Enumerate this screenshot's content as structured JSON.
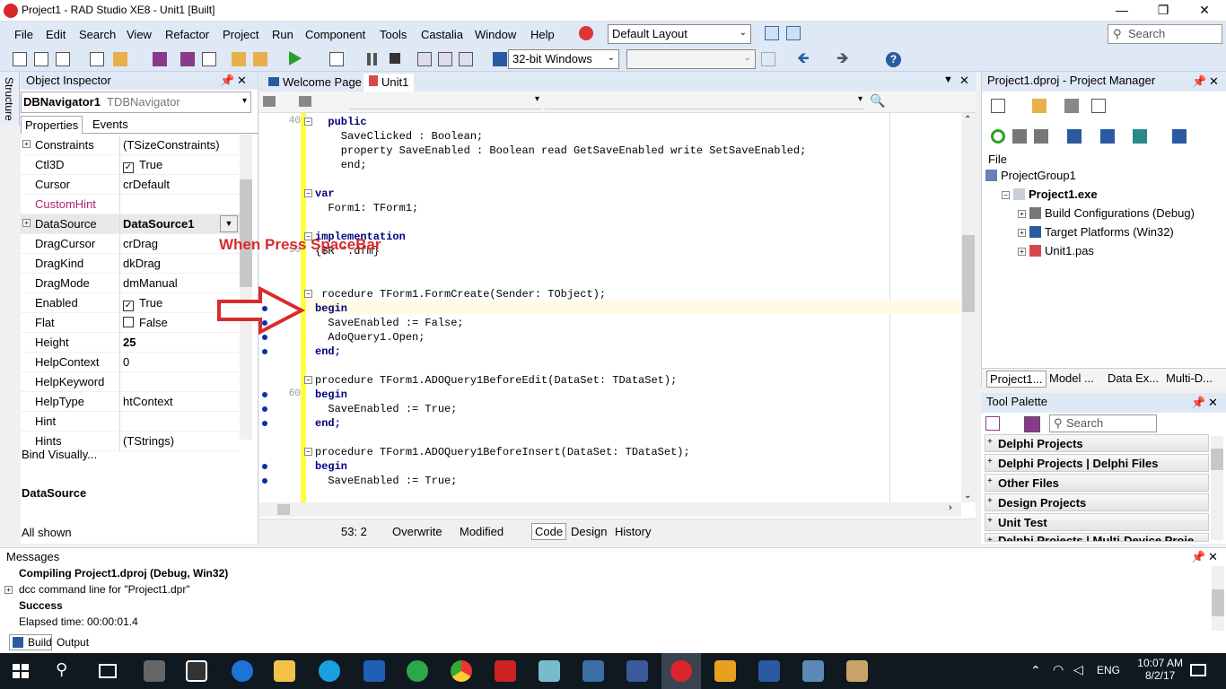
{
  "window": {
    "title": "Project1 - RAD Studio XE8 - Unit1 [Built]",
    "minimize": "—",
    "maximize": "❐",
    "close": "✕"
  },
  "menu": {
    "items": [
      "File",
      "Edit",
      "Search",
      "View",
      "Refactor",
      "Project",
      "Run",
      "Component",
      "Tools",
      "Castalia",
      "Window",
      "Help"
    ],
    "layout": "Default Layout",
    "search_placeholder": "Search"
  },
  "toolbar": {
    "platform": "32-bit Windows"
  },
  "object_inspector": {
    "title": "Object Inspector",
    "structure_tab": "Structure",
    "component_name": "DBNavigator1",
    "component_type": "TDBNavigator",
    "tabs": [
      "Properties",
      "Events"
    ],
    "properties": [
      {
        "name": "Constraints",
        "value": "(TSizeConstraints)",
        "expand": "+"
      },
      {
        "name": "Ctl3D",
        "value": "True",
        "check": "✓"
      },
      {
        "name": "Cursor",
        "value": "crDefault"
      },
      {
        "name": "CustomHint",
        "value": ""
      },
      {
        "name": "DataSource",
        "value": "DataSource1",
        "expand": "+"
      },
      {
        "name": "DragCursor",
        "value": "crDrag"
      },
      {
        "name": "DragKind",
        "value": "dkDrag"
      },
      {
        "name": "DragMode",
        "value": "dmManual"
      },
      {
        "name": "Enabled",
        "value": "True",
        "check": "✓"
      },
      {
        "name": "Flat",
        "value": "False",
        "check": " "
      },
      {
        "name": "Height",
        "value": "25"
      },
      {
        "name": "HelpContext",
        "value": "0"
      },
      {
        "name": "HelpKeyword",
        "value": ""
      },
      {
        "name": "HelpType",
        "value": "htContext"
      },
      {
        "name": "Hint",
        "value": ""
      },
      {
        "name": "Hints",
        "value": "(TStrings)"
      }
    ],
    "bind_visually": "Bind Visually...",
    "selected_property": "DataSource",
    "footer": "All shown"
  },
  "editor": {
    "tabs": [
      "Welcome Page",
      "Unit1"
    ],
    "lines": [
      {
        "n": "40",
        "t": "  public",
        "kw": true
      },
      {
        "n": "",
        "t": "    SaveClicked : Boolean;"
      },
      {
        "n": "",
        "t": "    property SaveEnabled : Boolean read GetSaveEnabled write SetSaveEnabled;"
      },
      {
        "n": "",
        "t": "    end;"
      },
      {
        "n": "",
        "t": ""
      },
      {
        "n": "",
        "t": "var",
        "kw": true
      },
      {
        "n": "",
        "t": "  Form1: TForm1;"
      },
      {
        "n": "",
        "t": ""
      },
      {
        "n": "",
        "t": "implementation",
        "kw": true
      },
      {
        "n": "50",
        "t": "{$R *.dfm}"
      },
      {
        "n": "",
        "t": ""
      },
      {
        "n": "",
        "t": ""
      },
      {
        "n": "",
        "t": " rocedure TForm1.FormCreate(Sender: TObject);"
      },
      {
        "n": "",
        "t": "begin",
        "kw": true
      },
      {
        "n": "",
        "t": "  SaveEnabled := False;"
      },
      {
        "n": "",
        "t": "  AdoQuery1.Open;"
      },
      {
        "n": "",
        "t": "end;",
        "kw": true
      },
      {
        "n": "",
        "t": ""
      },
      {
        "n": "",
        "t": "procedure TForm1.ADOQuery1BeforeEdit(DataSet: TDataSet);"
      },
      {
        "n": "60",
        "t": "begin",
        "kw": true
      },
      {
        "n": "",
        "t": "  SaveEnabled := True;"
      },
      {
        "n": "",
        "t": "end;",
        "kw": true
      },
      {
        "n": "",
        "t": ""
      },
      {
        "n": "",
        "t": "procedure TForm1.ADOQuery1BeforeInsert(DataSet: TDataSet);"
      },
      {
        "n": "",
        "t": "begin",
        "kw": true
      },
      {
        "n": "",
        "t": "  SaveEnabled := True;"
      }
    ],
    "annotation": "When Press SpaceBar",
    "status": {
      "position": "53:   2",
      "mode": "Overwrite",
      "state": "Modified",
      "views": [
        "Code",
        "Design",
        "History"
      ]
    }
  },
  "project_manager": {
    "title": "Project1.dproj - Project Manager",
    "file_label": "File",
    "tree": [
      {
        "label": "ProjectGroup1",
        "indent": 0
      },
      {
        "label": "Project1.exe",
        "indent": 1,
        "bold": true
      },
      {
        "label": "Build Configurations (Debug)",
        "indent": 2
      },
      {
        "label": "Target Platforms (Win32)",
        "indent": 2
      },
      {
        "label": "Unit1.pas",
        "indent": 2
      }
    ],
    "tabs": [
      "Project1...",
      "Model ...",
      "Data Ex...",
      "Multi-D..."
    ]
  },
  "tool_palette": {
    "title": "Tool Palette",
    "search_placeholder": "Search",
    "categories": [
      "Delphi Projects",
      "Delphi Projects | Delphi Files",
      "Other Files",
      "Design Projects",
      "Unit Test",
      "Delphi Projects | Multi-Device Proje..."
    ]
  },
  "messages": {
    "title": "Messages",
    "lines": [
      {
        "t": "Compiling Project1.dproj (Debug, Win32)",
        "bold": true
      },
      {
        "t": "dcc command line for \"Project1.dpr\"",
        "expand": true
      },
      {
        "t": "Success",
        "bold": true
      },
      {
        "t": "Elapsed time: 00:00:01.4"
      }
    ],
    "tabs": [
      "Build",
      "Output"
    ]
  },
  "taskbar": {
    "time": "10:07 AM",
    "date": "8/2/17",
    "lang": "ENG"
  },
  "colors": {
    "accent": "#dfe8f5",
    "keyword": "#000080",
    "annotation": "#d92b2b"
  }
}
